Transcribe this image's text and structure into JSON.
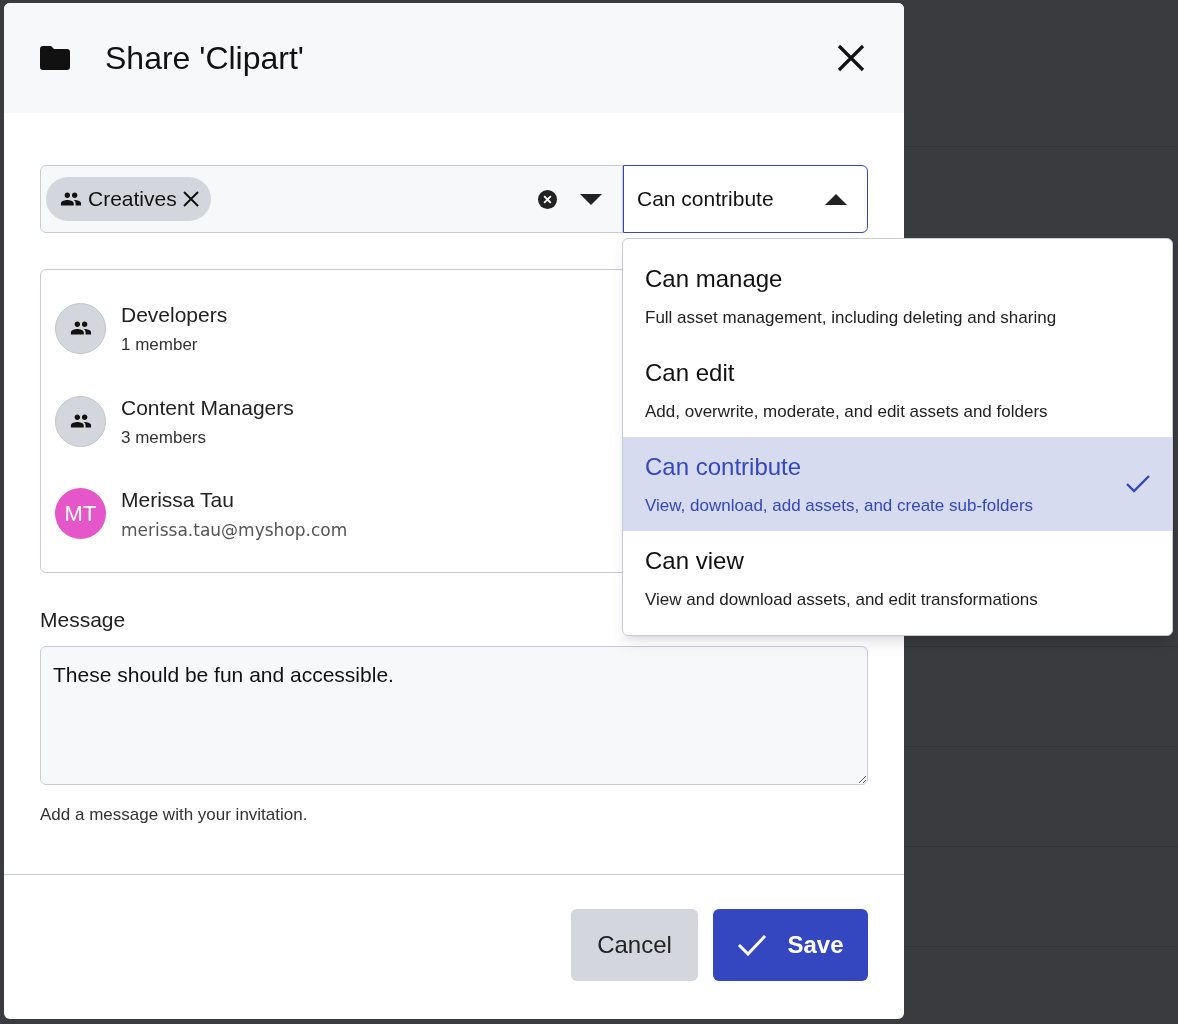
{
  "dialog": {
    "title": "Share 'Clipart'"
  },
  "recipients": {
    "chips": [
      {
        "label": "Creatives"
      }
    ]
  },
  "permission": {
    "value": "Can contribute",
    "expanded": true,
    "options": [
      {
        "label": "Can manage",
        "description": "Full asset management, including deleting and sharing",
        "selected": false
      },
      {
        "label": "Can edit",
        "description": "Add, overwrite, moderate, and edit assets and folders",
        "selected": false
      },
      {
        "label": "Can contribute",
        "description": "View, download, add assets, and create sub-folders",
        "selected": true
      },
      {
        "label": "Can view",
        "description": "View and download assets, and edit transformations",
        "selected": false
      }
    ]
  },
  "members": [
    {
      "kind": "group",
      "name": "Developers",
      "detail": "1 member"
    },
    {
      "kind": "group",
      "name": "Content Managers",
      "detail": "3 members"
    },
    {
      "kind": "user",
      "initials": "MT",
      "name": "Merissa Tau",
      "detail": "merissa.tau@myshop.com",
      "color": "#e556c8"
    }
  ],
  "message": {
    "label": "Message",
    "value": "These should be fun and accessible.",
    "hint": "Add a message with your invitation."
  },
  "buttons": {
    "cancel": "Cancel",
    "save": "Save"
  }
}
